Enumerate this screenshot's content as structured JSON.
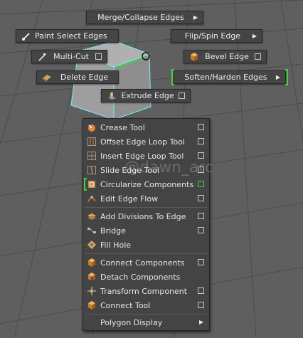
{
  "marking_menu": {
    "merge_collapse": "Merge/Collapse Edges",
    "paint_select": "Paint Select Edges",
    "flip_spin": "Flip/Spin Edge",
    "multi_cut": "Multi-Cut",
    "bevel_edge": "Bevel Edge",
    "delete_edge": "Delete Edge",
    "soften_harden": "Soften/Harden Edges",
    "extrude_edge": "Extrude Edge"
  },
  "menu": {
    "items": [
      {
        "label": "Crease Tool"
      },
      {
        "label": "Offset Edge Loop Tool"
      },
      {
        "label": "Insert Edge Loop Tool"
      },
      {
        "label": "Slide Edge Tool"
      },
      {
        "label": "Circularize Components"
      },
      {
        "label": "Edit Edge Flow"
      },
      {
        "label": "Add Divisions To Edge"
      },
      {
        "label": "Bridge"
      },
      {
        "label": "Fill Hole"
      },
      {
        "label": "Connect Components"
      },
      {
        "label": "Detach Components"
      },
      {
        "label": "Transform Component"
      },
      {
        "label": "Connect Tool"
      },
      {
        "label": "Polygon Display"
      }
    ]
  },
  "watermark": "@dawn_arc",
  "colors": {
    "viewport_bg": "#5e5e5e",
    "grid_line": "#4a4a4a",
    "menu_bg": "#444444",
    "highlight_green": "#3fd43f",
    "selection_cyan": "#7fe9ff"
  },
  "icons": {
    "paint_select": "paint-brush-icon",
    "multi_cut": "knife-icon",
    "bevel_edge": "bevel-cube-icon",
    "delete_edge": "eraser-icon",
    "extrude_edge": "extrude-icon"
  }
}
